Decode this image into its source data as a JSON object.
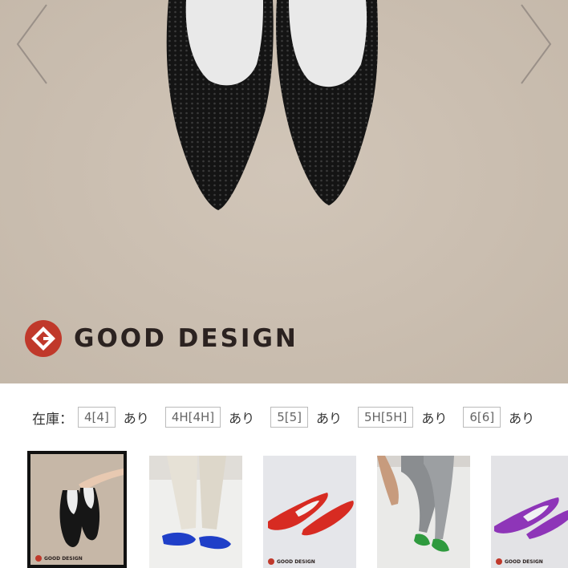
{
  "hero": {
    "badge_text": "GOOD DESIGN",
    "prev_icon": "chevron-left-icon",
    "next_icon": "chevron-right-icon",
    "colors": {
      "background": "#ccbfb0",
      "shoe": "#151515",
      "logo_red": "#c0392b"
    }
  },
  "stock": {
    "label": "在庫：",
    "sizes": [
      {
        "size": "4[4]",
        "availability": "あり"
      },
      {
        "size": "4H[4H]",
        "availability": "あり"
      },
      {
        "size": "5[5]",
        "availability": "あり"
      },
      {
        "size": "5H[5H]",
        "availability": "あり"
      },
      {
        "size": "6[6]",
        "availability": "あり"
      }
    ]
  },
  "thumbnails": [
    {
      "color_name": "black",
      "color": "#1a1a1a",
      "badge_text": "GOOD DESIGN",
      "selected": true
    },
    {
      "color_name": "blue",
      "color": "#1f3fc8",
      "badge_text": "",
      "selected": false
    },
    {
      "color_name": "red",
      "color": "#d72b22",
      "badge_text": "GOOD DESIGN",
      "selected": false
    },
    {
      "color_name": "green",
      "color": "#2f9a3e",
      "badge_text": "",
      "selected": false
    },
    {
      "color_name": "purple",
      "color": "#8e35b8",
      "badge_text": "GOOD DESIGN",
      "selected": false
    }
  ]
}
